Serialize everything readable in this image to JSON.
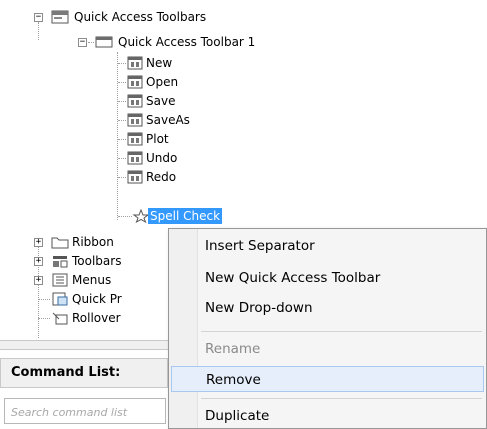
{
  "tree": {
    "nodes": [
      {
        "label": "Quick Access Toolbars",
        "icon": "quick-access-toolbars-icon",
        "expander": "−"
      },
      {
        "label": "Quick Access Toolbar 1",
        "icon": "toolbar-icon",
        "expander": "−"
      },
      {
        "label": "New",
        "icon": "command-icon"
      },
      {
        "label": "Open",
        "icon": "command-icon"
      },
      {
        "label": "Save",
        "icon": "command-icon"
      },
      {
        "label": "SaveAs",
        "icon": "command-icon"
      },
      {
        "label": "Plot",
        "icon": "command-icon"
      },
      {
        "label": "Undo",
        "icon": "command-icon"
      },
      {
        "label": "Redo",
        "icon": "command-icon"
      },
      {
        "label": "Spell Check",
        "icon": "star-icon",
        "selected": true
      },
      {
        "label": "Ribbon",
        "icon": "folder-icon",
        "expander": "+"
      },
      {
        "label": "Toolbars",
        "icon": "toolbars-icon",
        "expander": "+"
      },
      {
        "label": "Menus",
        "icon": "menus-icon",
        "expander": "+"
      },
      {
        "label": "Quick Pr",
        "icon": "quick-properties-icon"
      },
      {
        "label": "Rollover",
        "icon": "rollover-icon"
      }
    ]
  },
  "command_list": {
    "title": "Command List:",
    "search_placeholder": "Search command list"
  },
  "context_menu": {
    "items": [
      {
        "label": "Insert Separator",
        "enabled": true
      },
      {
        "label": "New Quick Access Toolbar",
        "enabled": true
      },
      {
        "label": "New Drop-down",
        "enabled": true
      },
      {
        "label": "Rename",
        "enabled": false
      },
      {
        "label": "Remove",
        "enabled": true,
        "hover": true
      },
      {
        "label": "Duplicate",
        "enabled": true
      }
    ]
  },
  "colors": {
    "selection": "#3399ff",
    "menu_hover": "#e6eefb",
    "menu_border": "#979797"
  }
}
